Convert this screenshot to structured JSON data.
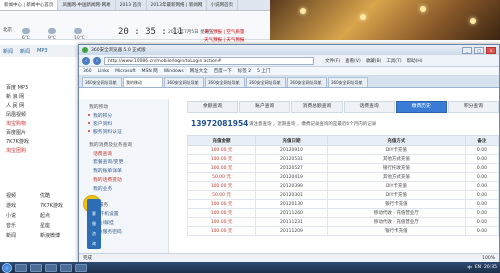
{
  "background": {
    "tabs": [
      "新闻中心 | 新闻中心首页",
      "凤凰网-中国新闻网-网易",
      "2013 首页",
      "2013年最新网络 | 新闻网",
      "小说网首页"
    ],
    "city": "北京",
    "weather_text": "今天",
    "temps": [
      "6℃",
      "9℃",
      "10℃"
    ],
    "clock": "20 : 35 : 11",
    "date_text": "2013年7月5日 星期五",
    "links": [
      "天气预报 | 空气质量",
      "天气预报 | 天气预报"
    ],
    "nav": [
      "新闻",
      "新闻",
      "MP3"
    ],
    "side_items": [
      {
        "label": "百度 MP3",
        "red": false
      },
      {
        "label": "新 浪 网",
        "red": false
      },
      {
        "label": "人 民 网",
        "red": false
      },
      {
        "label": "凤凰视频",
        "red": false
      },
      {
        "label": "淘宝购物",
        "red": true
      },
      {
        "label": "百度图片",
        "red": false
      },
      {
        "label": "7K7K游戏",
        "red": false
      },
      {
        "label": "淘宝团购",
        "red": true
      },
      {
        "label": "视频",
        "red": false
      },
      {
        "label": "游戏",
        "red": false
      },
      {
        "label": "小说",
        "red": false
      },
      {
        "label": "音乐",
        "red": false
      },
      {
        "label": "新闻",
        "red": false
      },
      {
        "label": "优酷",
        "red": false
      },
      {
        "label": "7K7K游戏",
        "red": false
      },
      {
        "label": "起点",
        "red": false
      },
      {
        "label": "星座",
        "red": false
      },
      {
        "label": "新浪微博",
        "red": false
      }
    ]
  },
  "browser": {
    "title": "360安全浏览器 5.0 正式版",
    "url": "http://www.10086.cn/mobile/login/toLogin.action#",
    "menus": [
      "文件(F)",
      "查看(V)",
      "收藏(B)",
      "工具(T)",
      "帮助(H)"
    ],
    "favorites": [
      "360",
      "Links",
      "Microsoft",
      "MSN 网",
      "Windows",
      "网址大全",
      "百度一下",
      "标签 2",
      "5 上门"
    ],
    "tabs": [
      "360安全网址导航",
      "我的移动",
      "360安全网址导航",
      "360安全网址导航",
      "360安全网址导航",
      "360安全网址导航",
      "360安全网址导航"
    ],
    "active_tab_index": 1,
    "window_controls": [
      "_",
      "□",
      "×"
    ]
  },
  "leftnav": {
    "section1": "我的移动",
    "items1": [
      "我的积分",
      "客户资料",
      "服务资料认证"
    ],
    "section2": "我的消费及业务查询",
    "items2": [
      "话费查询",
      "套餐查询/变更",
      "我的账单详单",
      "我的话费变动",
      "我的业务"
    ],
    "section3": "自助服务",
    "items3": [
      "停/开机设置",
      "挂失/解挂",
      "修改服务密码"
    ],
    "dock_label": "在线",
    "dock_items": [
      "客",
      "服",
      "咨",
      "询"
    ]
  },
  "subtabs": [
    {
      "label": "余额查询",
      "active": false
    },
    {
      "label": "账户查询",
      "active": false
    },
    {
      "label": "消费总额查询",
      "active": false
    },
    {
      "label": "话费查询",
      "active": false
    },
    {
      "label": "缴费历史",
      "active": true
    },
    {
      "label": "积分查询",
      "active": false
    }
  ],
  "account": {
    "phone": "13972081954",
    "note": "请注意查询 ，近期查询 ，缴费记录查询的是最近6个月内的记录"
  },
  "table": {
    "headers": [
      "充值金额",
      "充值日期",
      "充值方式",
      "备注"
    ],
    "rows": [
      [
        "100.00 元",
        "20120910",
        "DIY卡充值",
        "0.00"
      ],
      [
        "100.00 元",
        "20120531",
        "其他方式充值",
        "0.00"
      ],
      [
        "100.00 元",
        "20120527",
        "银行托收充值",
        "0.00"
      ],
      [
        "50.00 元",
        "20120419",
        "其他方式充值",
        "0.00"
      ],
      [
        "100.00 元",
        "20120399",
        "DIY卡充值",
        "0.00"
      ],
      [
        "50.00 元",
        "20120301",
        "DIY卡充值",
        "0.00"
      ],
      [
        "100.00 元",
        "20120130",
        "银行卡充值",
        "0.00"
      ],
      [
        "100.00 元",
        "20111260",
        "移动代收 - 充值营业厅",
        "0.00"
      ],
      [
        "100.00 元",
        "20111231",
        "移动代收 - 充值营业厅",
        "0.00"
      ],
      [
        "100.00 元",
        "20111209",
        "银行卡充值",
        "0.00"
      ]
    ]
  },
  "statusbar": {
    "left": "完成",
    "zoom": "100%"
  },
  "taskbar": {
    "time": "20:35",
    "tray": [
      "中",
      "EN"
    ]
  }
}
